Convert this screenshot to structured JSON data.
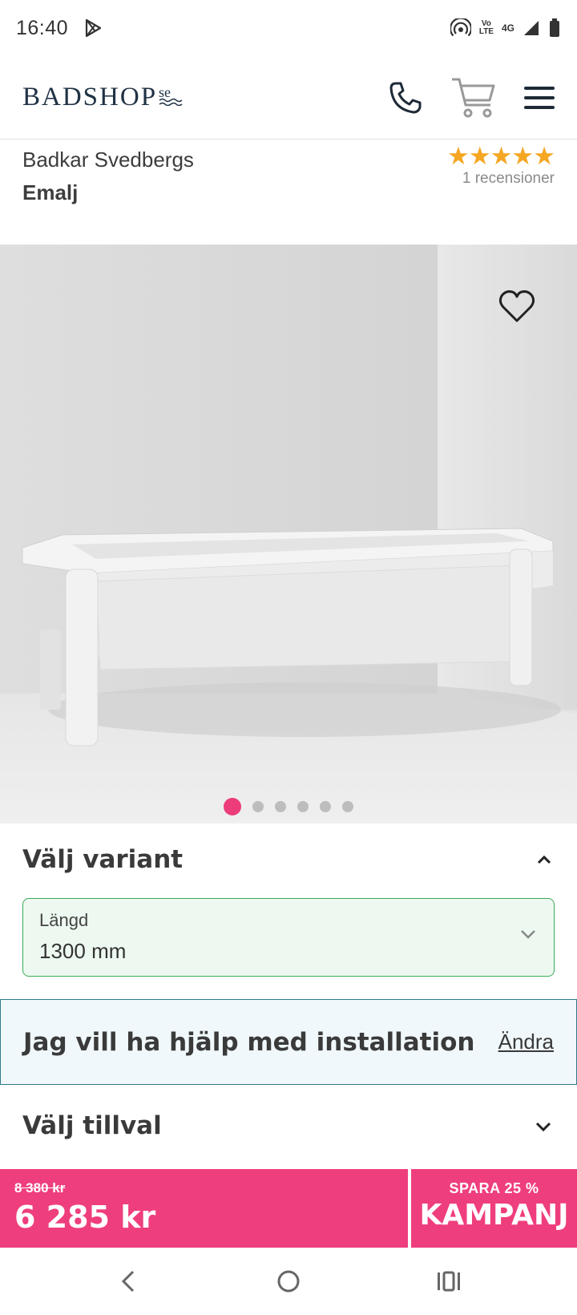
{
  "status_bar": {
    "time": "16:40",
    "volte": "Vo LTE",
    "network": "4G"
  },
  "header": {
    "logo": "BADSHOP",
    "logo_suffix": "se",
    "icons": [
      "phone-icon",
      "cart-icon",
      "menu-icon"
    ]
  },
  "product": {
    "title_line1": "Badkar Svedbergs",
    "title_line2": "Emalj",
    "rating_stars": 5,
    "stars_text": "★★★★★",
    "reviews": "1 recensioner"
  },
  "gallery": {
    "image_count": 6,
    "active_index": 0
  },
  "variant": {
    "title": "Välj variant",
    "field_label": "Längd",
    "field_value": "1300 mm"
  },
  "installation": {
    "title": "Jag vill ha hjälp med installation",
    "link": "Ändra"
  },
  "addons": {
    "title": "Välj tillval"
  },
  "price": {
    "old": "8 380 kr",
    "current": "6 285 kr",
    "save": "SPARA 25 %",
    "campaign": "KAMPANJ"
  },
  "colors": {
    "accent_pink": "#ef3e7d",
    "star": "#f5a623",
    "select_border": "#3cab57",
    "install_border": "#2e7a8c"
  }
}
